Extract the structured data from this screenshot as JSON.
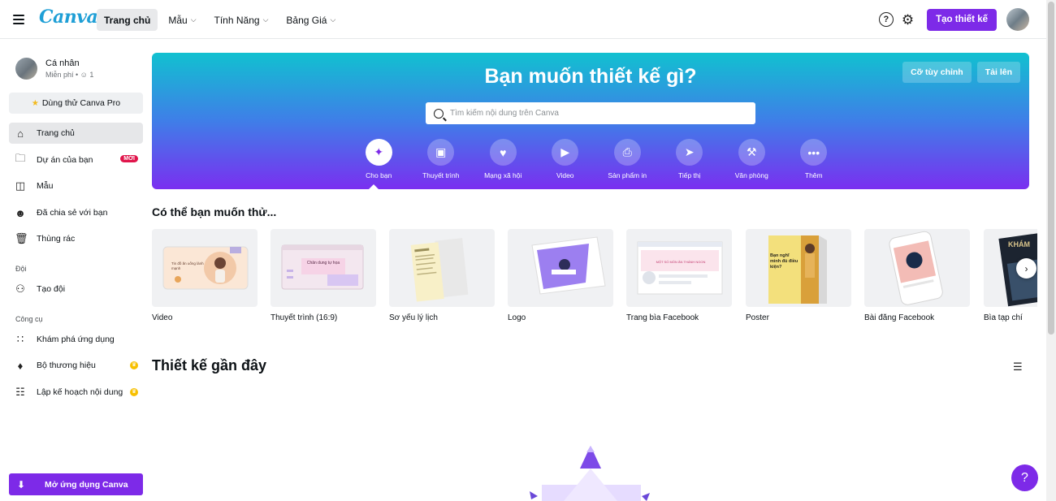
{
  "topbar": {
    "logo": "Canva",
    "nav": [
      {
        "label": "Trang chủ",
        "active": true
      },
      {
        "label": "Mẫu"
      },
      {
        "label": "Tính Năng"
      },
      {
        "label": "Bảng Giá"
      }
    ],
    "help_glyph": "?",
    "create_label": "Tạo thiết kế"
  },
  "sidebar": {
    "profile_name": "Cá nhân",
    "profile_sub": "Miễn phí • ",
    "member_count": "1",
    "pro_label": "Dùng thử Canva Pro",
    "items": [
      {
        "label": "Trang chủ",
        "icon": "home-icon"
      },
      {
        "label": "Dự án của bạn",
        "icon": "folder-icon",
        "badge": "MỚI"
      },
      {
        "label": "Mẫu",
        "icon": "templates-icon"
      },
      {
        "label": "Đã chia sẻ với bạn",
        "icon": "shared-users-icon"
      },
      {
        "label": "Thùng rác",
        "icon": "trash-icon"
      }
    ],
    "team_section": "Đội",
    "team_items": [
      {
        "label": "Tạo đội",
        "icon": "team-icon"
      }
    ],
    "tools_section": "Công cụ",
    "tool_items": [
      {
        "label": "Khám phá ứng dụng",
        "icon": "apps-grid-icon"
      },
      {
        "label": "Bộ thương hiệu",
        "icon": "brand-kit-icon"
      },
      {
        "label": "Lập kế hoạch nội dung",
        "icon": "calendar-icon"
      }
    ],
    "open_app_label": "Mở ứng dụng Canva"
  },
  "hero": {
    "title": "Bạn muốn thiết kế gì?",
    "custom_size_label": "Cỡ tùy chỉnh",
    "upload_label": "Tải lên",
    "search_placeholder": "Tìm kiếm nội dung trên Canva",
    "categories": [
      {
        "label": "Cho bạn",
        "icon": "sparkle-icon",
        "active": true
      },
      {
        "label": "Thuyết trình",
        "icon": "presentation-icon"
      },
      {
        "label": "Mạng xã hội",
        "icon": "heart-chat-icon"
      },
      {
        "label": "Video",
        "icon": "video-camera-icon"
      },
      {
        "label": "Sản phẩm in",
        "icon": "printer-icon"
      },
      {
        "label": "Tiếp thị",
        "icon": "megaphone-icon"
      },
      {
        "label": "Văn phòng",
        "icon": "briefcase-icon"
      },
      {
        "label": "Thêm",
        "icon": "more-icon"
      }
    ]
  },
  "suggestions": {
    "title": "Có thể bạn muốn thử...",
    "cards": [
      {
        "label": "Video",
        "thumb_text": "Tin đồ ăn uống lành mạnh"
      },
      {
        "label": "Thuyết trình (16:9)",
        "thumb_text": "Chân dung tự họa"
      },
      {
        "label": "Sơ yếu lý lịch",
        "thumb_text": ""
      },
      {
        "label": "Logo",
        "thumb_text": ""
      },
      {
        "label": "Trang bìa Facebook",
        "thumb_text": "MỘT SỐ MÓN ĂN THÁNH NGON"
      },
      {
        "label": "Poster",
        "thumb_text": "Bạn nghĩ mình đủ điều kiện?"
      },
      {
        "label": "Bài đăng Facebook",
        "thumb_text": ""
      },
      {
        "label": "Bìa tạp chí",
        "thumb_text": "KHÁM"
      }
    ]
  },
  "recent": {
    "title": "Thiết kế gần đây"
  },
  "help_glyph": "?"
}
